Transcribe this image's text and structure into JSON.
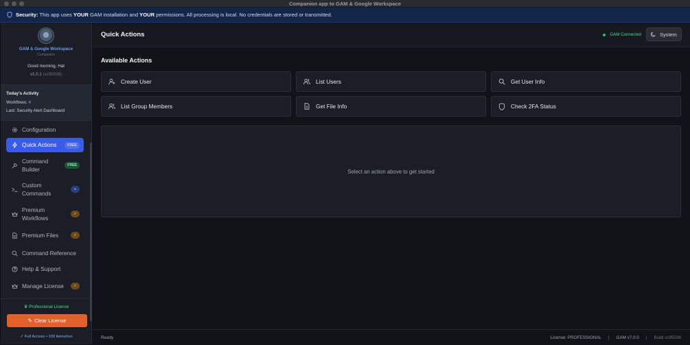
{
  "window": {
    "title": "Companion app to GAM & Google Workspace"
  },
  "banner": {
    "label": "Security:",
    "text_1": "This app uses",
    "your_1": "YOUR",
    "text_2": "GAM installation and",
    "your_2": "YOUR",
    "text_3": "permissions. All processing is local. No credentials are stored or transmitted."
  },
  "sidebar": {
    "app_name": "GAM & Google Workspace",
    "app_sub": "Companion",
    "greeting": "Good morning, Hal",
    "version": "v1.0.1",
    "build": "(cc95036)",
    "activity": {
      "heading": "Today's Activity",
      "workflows_label": "Workflows:",
      "workflows_count": "4",
      "last": "Last: Security Alert Dashboard"
    },
    "nav": [
      {
        "label": "Configuration",
        "icon": "gear-icon"
      },
      {
        "label": "Quick Actions",
        "icon": "lightning-icon",
        "badge": "FREE",
        "active": true
      },
      {
        "label_1": "Command",
        "label_2": "Builder",
        "icon": "wrench-icon",
        "badge": "FREE"
      },
      {
        "label_1": "Custom",
        "label_2": "Commands",
        "icon": "terminal-icon",
        "badge": "∞"
      },
      {
        "label_1": "Premium",
        "label_2": "Workflows",
        "icon": "crown-icon",
        "badge": "✓"
      },
      {
        "label": "Premium Files",
        "icon": "document-icon",
        "badge": "✓"
      },
      {
        "label": "Command Reference",
        "icon": "search-icon"
      },
      {
        "label": "Help & Support",
        "icon": "help-icon"
      },
      {
        "label": "Manage License",
        "icon": "crown-icon",
        "badge": "✓"
      }
    ],
    "license": {
      "status": "Professional License",
      "clear_button": "Clear License",
      "access": "✓ Full Access • 100 items/run"
    }
  },
  "main": {
    "title": "Quick Actions",
    "gam_status": "GAM Connected",
    "theme_button": "System",
    "section_title": "Available Actions",
    "actions": [
      {
        "label": "Create User",
        "icon": "user-plus-icon"
      },
      {
        "label": "List Users",
        "icon": "users-icon"
      },
      {
        "label": "Get User Info",
        "icon": "search-icon"
      },
      {
        "label": "List Group Members",
        "icon": "users-icon"
      },
      {
        "label": "Get File Info",
        "icon": "file-icon"
      },
      {
        "label": "Check 2FA Status",
        "icon": "shield-icon"
      }
    ],
    "empty_message": "Select an action above to get started"
  },
  "statusbar": {
    "status": "Ready",
    "license": "License: PROFESSIONAL",
    "separator": "|",
    "gam_version": "GAM v7.0.0",
    "build": "Build cc95036"
  },
  "colors": {
    "accent": "#3a5be8",
    "banner_bg": "#14254a",
    "success": "#22c55e",
    "clear_button": "#e4602a",
    "badge_free": "#1f5236",
    "badge_check": "#6b4a1c"
  }
}
